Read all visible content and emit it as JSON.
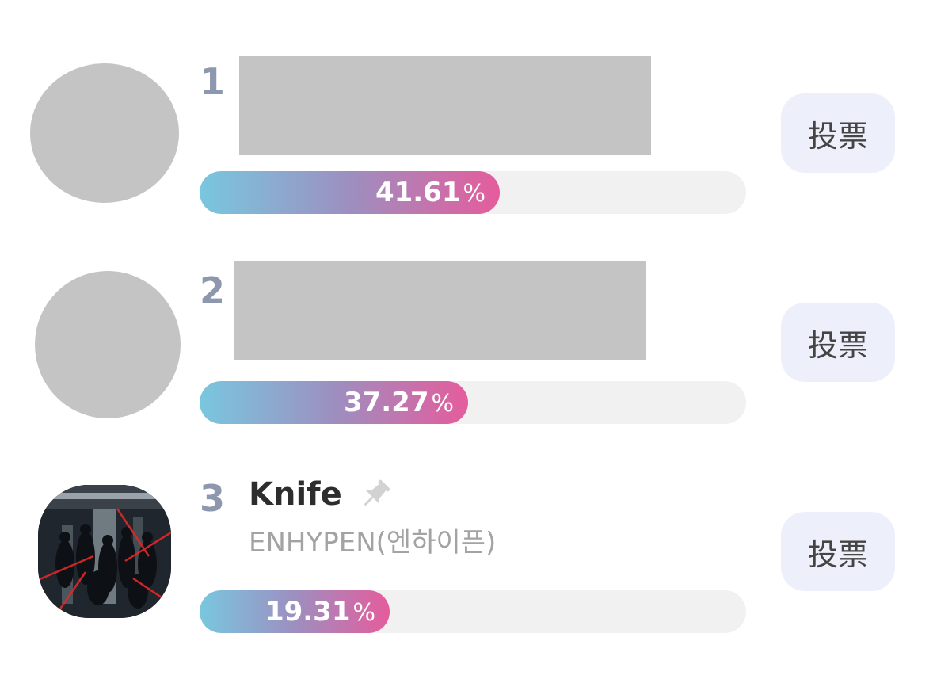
{
  "entries": [
    {
      "rank": "1",
      "percent_value": "41.61",
      "percent_sign": "%",
      "share": 0.4161,
      "vote_label": "投票"
    },
    {
      "rank": "2",
      "percent_value": "37.27",
      "percent_sign": "%",
      "share": 0.3727,
      "vote_label": "投票"
    },
    {
      "rank": "3",
      "title": "Knife",
      "artist": "ENHYPEN(엔하이픈)",
      "percent_value": "19.31",
      "percent_sign": "%",
      "share": 0.1931,
      "vote_label": "投票"
    }
  ],
  "colors": {
    "rank": "#8d97ae",
    "gradient_start": "#79c7df",
    "gradient_end": "#e55c9c",
    "track": "#f1f1f1",
    "vote_button_bg": "#edf0fa"
  },
  "icons": {
    "pin": "pin-icon"
  }
}
